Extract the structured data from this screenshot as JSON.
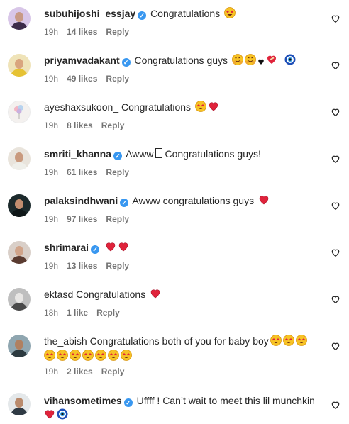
{
  "icons": {
    "like": "heart-outline-icon",
    "verified": "verified-badge-icon"
  },
  "comments": [
    {
      "user": "subuhijoshi_essjay",
      "verified": true,
      "text": "Congratulations",
      "time": "19h",
      "likes": "14 likes",
      "reply": "Reply"
    },
    {
      "user": "priyamvadakant",
      "verified": true,
      "text": "Congratulations guys",
      "time": "19h",
      "likes": "49 likes",
      "reply": "Reply"
    },
    {
      "user": "ayeshaxsukoon_",
      "verified": false,
      "text": "Congratulations",
      "time": "19h",
      "likes": "8 likes",
      "reply": "Reply"
    },
    {
      "user": "smriti_khanna",
      "verified": true,
      "text_before": "Awww",
      "text_after": "Congratulations guys!",
      "time": "19h",
      "likes": "61 likes",
      "reply": "Reply"
    },
    {
      "user": "palaksindhwani",
      "verified": true,
      "text": "Awww congratulations guys",
      "time": "19h",
      "likes": "97 likes",
      "reply": "Reply"
    },
    {
      "user": "shrimarai",
      "verified": true,
      "text": "",
      "time": "19h",
      "likes": "13 likes",
      "reply": "Reply"
    },
    {
      "user": "ektasd",
      "verified": false,
      "text": "Congratulations",
      "time": "18h",
      "likes": "1 like",
      "reply": "Reply"
    },
    {
      "user": "the_abish",
      "verified": false,
      "text": "Congratulations both of you for baby boy",
      "time": "19h",
      "likes": "2 likes",
      "reply": "Reply"
    },
    {
      "user": "vihansometimes",
      "verified": true,
      "text": "Uffff ! Can’t wait to meet this lil munchkin",
      "time": "",
      "likes": "",
      "reply": ""
    }
  ]
}
